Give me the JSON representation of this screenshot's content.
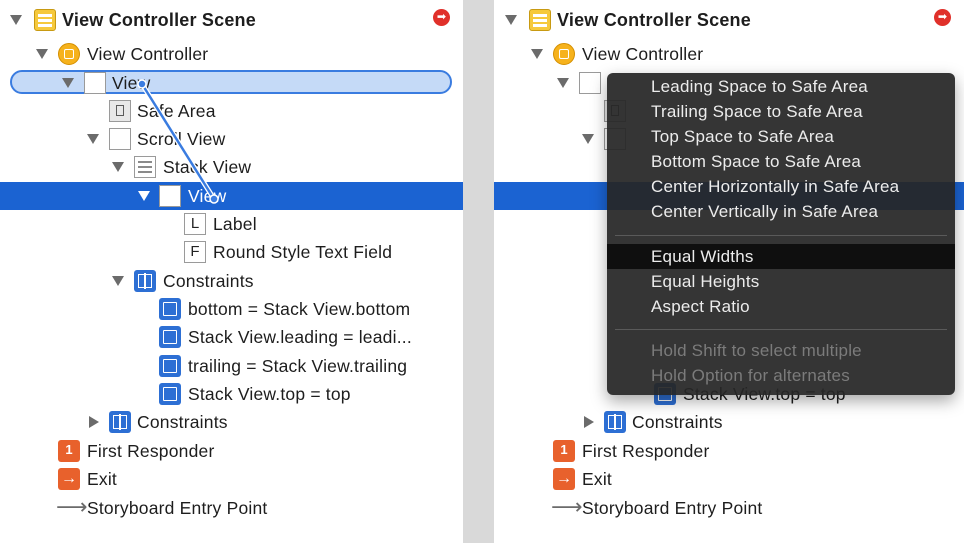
{
  "left_outline": {
    "scene_title": "View Controller Scene",
    "items": [
      {
        "label": "View Controller"
      },
      {
        "label": "View"
      },
      {
        "label": "Safe Area"
      },
      {
        "label": "Scroll View"
      },
      {
        "label": "Stack View"
      },
      {
        "label": "View"
      },
      {
        "label": "Label",
        "icon_letter": "L"
      },
      {
        "label": "Round Style Text Field",
        "icon_letter": "F"
      },
      {
        "label": "Constraints"
      },
      {
        "label": "bottom = Stack View.bottom"
      },
      {
        "label": "Stack View.leading = leadi..."
      },
      {
        "label": "trailing = Stack View.trailing"
      },
      {
        "label": "Stack View.top = top"
      },
      {
        "label": "Constraints"
      },
      {
        "label": "First Responder"
      },
      {
        "label": "Exit"
      },
      {
        "label": "Storyboard Entry Point"
      }
    ]
  },
  "right_outline": {
    "scene_title": "View Controller Scene",
    "items": [
      {
        "label": "View Controller"
      },
      {
        "label": "Stack View.top = top"
      },
      {
        "label": "Constraints"
      },
      {
        "label": "First Responder"
      },
      {
        "label": "Exit"
      },
      {
        "label": "Storyboard Entry Point"
      }
    ]
  },
  "context_menu": {
    "items": [
      {
        "label": "Leading Space to Safe Area"
      },
      {
        "label": "Trailing Space to Safe Area"
      },
      {
        "label": "Top Space to Safe Area"
      },
      {
        "label": "Bottom Space to Safe Area"
      },
      {
        "label": "Center Horizontally in Safe Area"
      },
      {
        "label": "Center Vertically in Safe Area"
      },
      {
        "label": "Equal Widths"
      },
      {
        "label": "Equal Heights"
      },
      {
        "label": "Aspect Ratio"
      }
    ],
    "hints": [
      {
        "label": "Hold Shift to select multiple"
      },
      {
        "label": "Hold Option for alternates"
      }
    ],
    "active_item": "Equal Widths"
  },
  "colors": {
    "selection": "#1b63d2",
    "drag_highlight": "#c5daf7",
    "drag_line": "#3a7ce0",
    "menu_bg": "#262626",
    "badge": "#e0302a"
  }
}
